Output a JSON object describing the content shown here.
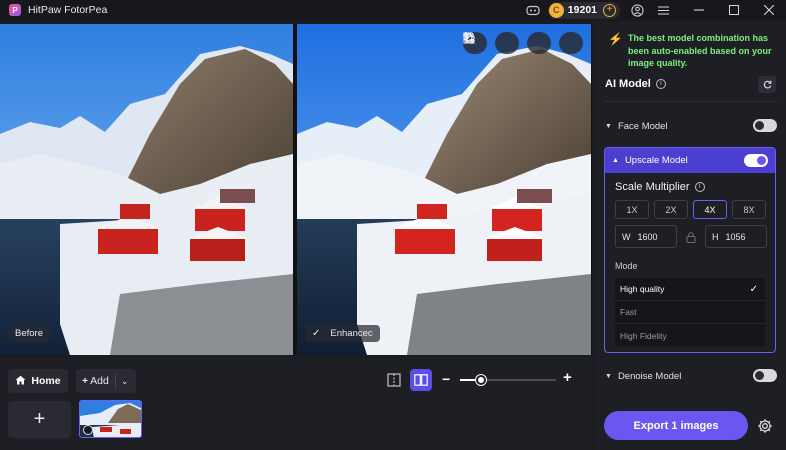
{
  "app": {
    "title": "HitPaw FotorPea",
    "logo_letter": "P"
  },
  "titlebar": {
    "coins": "19201",
    "coin_symbol": "C"
  },
  "preview": {
    "before_label": "Before",
    "after_label": "Enhancec"
  },
  "bottom": {
    "home_label": "Home",
    "add_label": "Add",
    "zoom_level": 0.22
  },
  "panel": {
    "notice": "The best model combination has been auto-enabled based on your image quality.",
    "ai_model_title": "AI Model",
    "face_model": {
      "label": "Face Model",
      "enabled": false
    },
    "upscale_model": {
      "label": "Upscale Model",
      "enabled": true
    },
    "scale_multiplier_title": "Scale Multiplier",
    "scale_options": [
      "1X",
      "2X",
      "4X",
      "8X"
    ],
    "scale_selected": "4X",
    "width_key": "W",
    "width_value": "1600",
    "height_key": "H",
    "height_value": "1056",
    "mode_label": "Mode",
    "mode_options": [
      "High quality",
      "Fast",
      "High Fidelity"
    ],
    "mode_selected": "High quality",
    "denoise_model": {
      "label": "Denoise Model",
      "enabled": false
    },
    "export_label": "Export 1 images"
  },
  "colors": {
    "accent": "#6a57f2",
    "notice_green": "#7cf07e",
    "coin": "#f2b13a"
  }
}
